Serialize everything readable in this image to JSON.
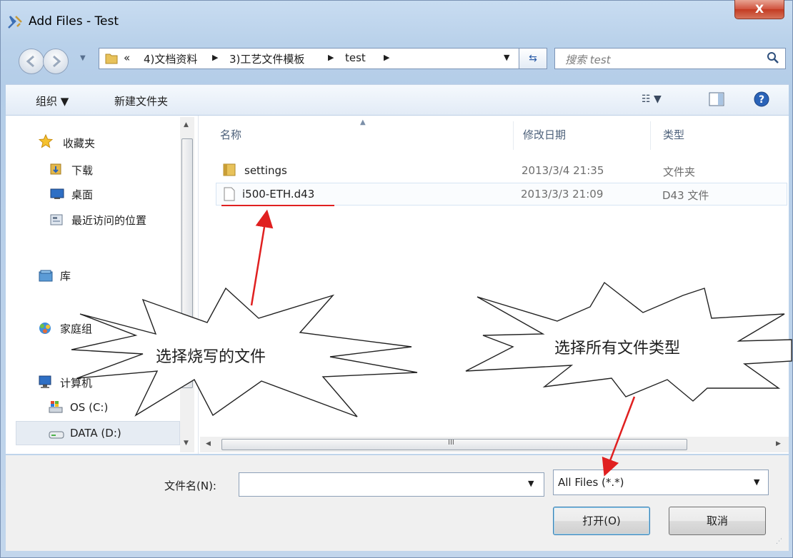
{
  "window": {
    "title": "Add Files - Test",
    "close_glyph": "X"
  },
  "address": {
    "overflow_glyph": "«",
    "crumbs": [
      "4)文档资料",
      "3)工艺文件模板",
      "test"
    ],
    "search_placeholder": "搜索 test"
  },
  "toolbar": {
    "organize": "组织 ▼",
    "new_folder": "新建文件夹"
  },
  "nav": {
    "favorites": "收藏夹",
    "downloads": "下载",
    "desktop": "桌面",
    "recent": "最近访问的位置",
    "libraries": "库",
    "homegroup": "家庭组",
    "computer": "计算机",
    "drive_c": "OS (C:)",
    "drive_d": "DATA (D:)"
  },
  "columns": {
    "name": "名称",
    "date": "修改日期",
    "type": "类型"
  },
  "files": [
    {
      "name": "settings",
      "date": "2013/3/4 21:35",
      "type": "文件夹",
      "icon": "folder-icon"
    },
    {
      "name": "i500-ETH.d43",
      "date": "2013/3/3 21:09",
      "type": "D43 文件",
      "icon": "file-icon"
    }
  ],
  "bottom": {
    "filename_label": "文件名(N):",
    "filename_value": "",
    "filter_value": "All Files (*.*)",
    "open_label": "打开(O)",
    "cancel_label": "取消"
  },
  "annotations": {
    "left_callout": "选择烧写的文件",
    "right_callout": "选择所有文件类型",
    "arrow_color": "#e02020"
  }
}
